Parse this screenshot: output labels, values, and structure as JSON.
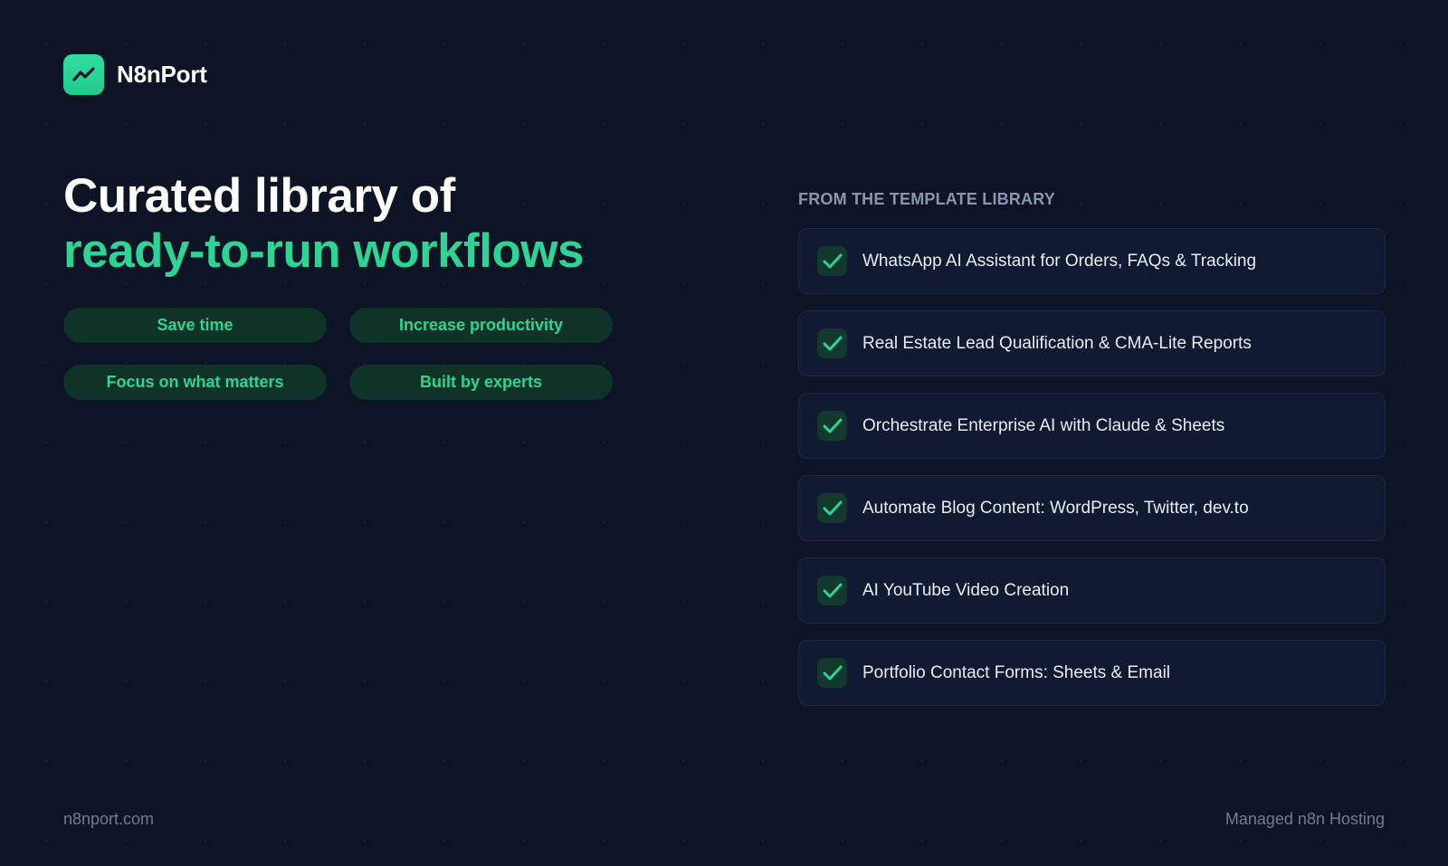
{
  "brand": {
    "name": "N8nPort",
    "icon": "trend-up-icon",
    "accent_color": "#2dd493"
  },
  "hero": {
    "title_line1": "Curated library of",
    "title_line2": "ready-to-run workflows"
  },
  "benefits": [
    {
      "label": "Save time"
    },
    {
      "label": "Increase productivity"
    },
    {
      "label": "Focus on what matters"
    },
    {
      "label": "Built by experts"
    }
  ],
  "library": {
    "heading": "FROM THE TEMPLATE LIBRARY",
    "item_icon": "check-icon",
    "items": [
      {
        "label": "WhatsApp AI Assistant for Orders, FAQs & Tracking"
      },
      {
        "label": "Real Estate Lead Qualification & CMA-Lite Reports"
      },
      {
        "label": "Orchestrate Enterprise AI with Claude & Sheets"
      },
      {
        "label": "Automate Blog Content: WordPress, Twitter, dev.to"
      },
      {
        "label": "AI YouTube Video Creation"
      },
      {
        "label": "Portfolio Contact Forms: Sheets & Email"
      }
    ]
  },
  "footer": {
    "website": "n8nport.com",
    "tagline": "Managed n8n Hosting"
  },
  "colors": {
    "background": "#0c1426",
    "card_background": "#111a30",
    "pill_background": "#0f3327",
    "muted_text": "#717c93"
  }
}
